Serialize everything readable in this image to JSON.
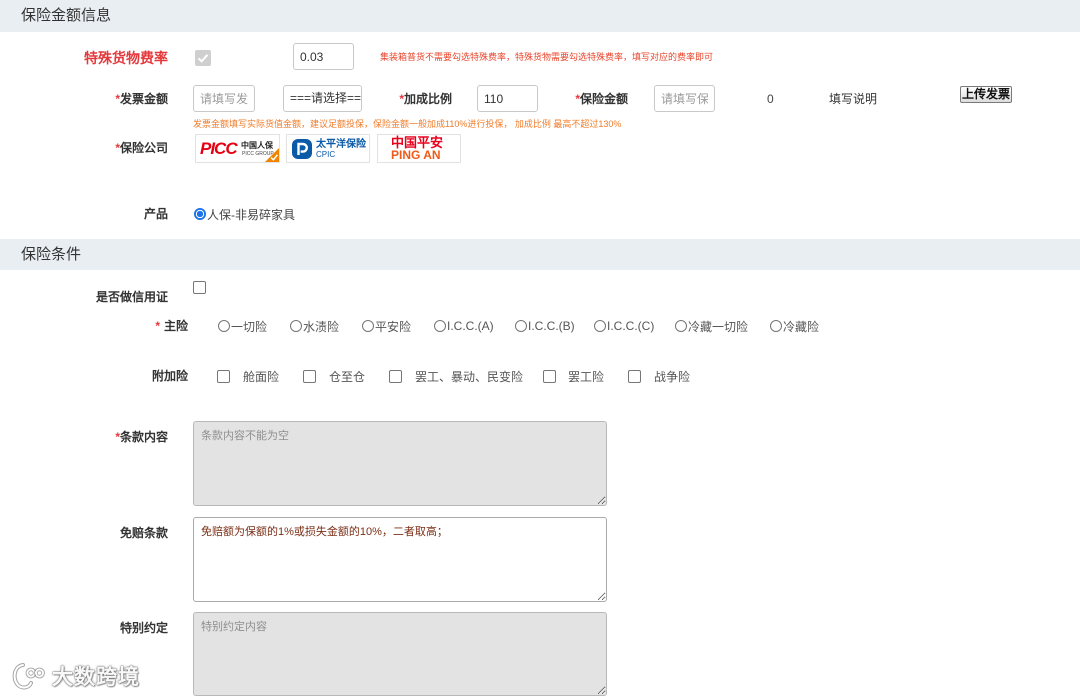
{
  "colors": {
    "section_bg": "#e9eef3",
    "required": "#e4393c",
    "special_label": "#e4393c",
    "note_red": "#e8452c",
    "note_orange": "#f07c2a",
    "selected_blue": "#1a73e8",
    "insurer_selected_badge": "#f08300",
    "deductible_text": "#7b2e16"
  },
  "amount_section": {
    "title": "保险金额信息",
    "special_rate": {
      "label": "特殊货物费率",
      "checked": true,
      "value": "0.03",
      "note": "集装箱普货不需要勾选特殊费率，特殊货物需要勾选特殊费率，填写对应的费率即可"
    },
    "invoice_amount": {
      "required": "*",
      "label": "发票金额",
      "placeholder": "请填写发票",
      "currency": "===请选择=="
    },
    "markup_ratio": {
      "required": "*",
      "label": "加成比例",
      "value": "110"
    },
    "insured_amount": {
      "required": "*",
      "label": "保险金额",
      "placeholder": "请填写保险",
      "computed": "0"
    },
    "help_link": "填写说明",
    "upload_button": "上传发票",
    "invoice_note": "发票金额填写实际货值金额，建议足额投保，保险金额一般加成110%进行投保， 加成比例 最高不超过130%",
    "insurer": {
      "required": "*",
      "label": "保险公司",
      "options": [
        {
          "name": "PICC",
          "cn": "中国人保",
          "sub": "PICC GROUP",
          "selected": true,
          "icon": "picc-logo"
        },
        {
          "name": "CPIC",
          "cn": "太平洋保险",
          "selected": false,
          "icon": "cpic-logo"
        },
        {
          "name": "PING AN",
          "cn": "中国平安",
          "selected": false,
          "icon": "pingan-logo"
        }
      ]
    },
    "product": {
      "label": "产品",
      "options": [
        {
          "label": "人保-非易碎家具",
          "selected": true
        }
      ]
    }
  },
  "conditions_section": {
    "title": "保险条件",
    "letter_of_credit": {
      "label": "是否做信用证",
      "checked": false
    },
    "main_risk": {
      "required": "*",
      "label": "主险",
      "options": [
        "一切险",
        "水渍险",
        "平安险",
        "I.C.C.(A)",
        "I.C.C.(B)",
        "I.C.C.(C)",
        "冷藏一切险",
        "冷藏险"
      ]
    },
    "additional_risk": {
      "label": "附加险",
      "options": [
        "舱面险",
        "仓至仓",
        "罢工、暴动、民变险",
        "罢工险",
        "战争险"
      ]
    },
    "clause_content": {
      "required": "*",
      "label": "条款内容",
      "placeholder": "条款内容不能为空"
    },
    "deductible": {
      "label": "免赔条款",
      "value": "免赔额为保额的1%或损失金额的10%，二者取高；"
    },
    "special_agreement": {
      "label": "特别约定",
      "placeholder": "特别约定内容"
    }
  },
  "watermark": {
    "text": "大数跨境",
    "icon": "watermark-logo"
  }
}
